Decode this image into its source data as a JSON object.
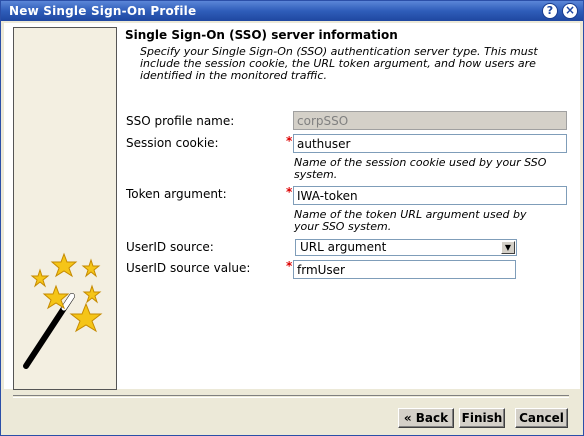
{
  "window": {
    "title": "New Single Sign-On Profile",
    "help_glyph": "?",
    "close_glyph": "×"
  },
  "section": {
    "heading": "Single Sign-On (SSO) server information",
    "description": "Specify your Single Sign-On (SSO) authentication server type. This must include the session cookie, the URL token argument, and how users are identified in the monitored traffic."
  },
  "form": {
    "profile_name": {
      "label": "SSO profile name:",
      "value": "corpSSO"
    },
    "session_cookie": {
      "label": "Session cookie:",
      "required_mark": "*",
      "value": "authuser",
      "hint": "Name of the session cookie used by your SSO system."
    },
    "token_argument": {
      "label": "Token argument:",
      "required_mark": "*",
      "value": "IWA-token",
      "hint": "Name of the token URL argument used by your SSO system."
    },
    "userid_source": {
      "label": "UserID source:",
      "selected": "URL argument"
    },
    "userid_source_value": {
      "label": "UserID source value:",
      "required_mark": "*",
      "value": "frmUser"
    }
  },
  "buttons": {
    "back": "« Back",
    "finish": "Finish",
    "cancel": "Cancel"
  },
  "colors": {
    "titlebar": "#2f5db9",
    "required": "#dd0000",
    "star": "#f5c518"
  },
  "icons": [
    "help-icon",
    "close-icon",
    "magic-wand-icon",
    "dropdown-arrow-icon"
  ]
}
